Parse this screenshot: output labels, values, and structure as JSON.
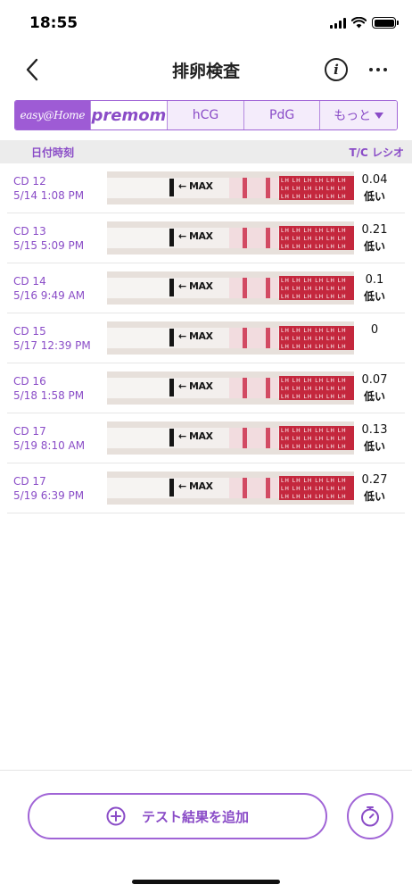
{
  "status_bar": {
    "time": "18:55"
  },
  "nav": {
    "title": "排卵検査"
  },
  "tabs": {
    "easy": "easy@Home",
    "premom": "premom",
    "hcg": "hCG",
    "pdg": "PdG",
    "more": "もっと"
  },
  "columns": {
    "date": "日付時刻",
    "ratio": "T/C レシオ"
  },
  "strip_text": {
    "max": "MAX",
    "lh": "LH LH LH LH LH LH LH LH LH LH LH LH LH LH LH LH LH LH LH LH LH LH LH LH"
  },
  "records": [
    {
      "cd": "CD 12",
      "date": "5/14 1:08 PM",
      "ratio": "0.04",
      "status": "低い"
    },
    {
      "cd": "CD 13",
      "date": "5/15 5:09 PM",
      "ratio": "0.21",
      "status": "低い"
    },
    {
      "cd": "CD 14",
      "date": "5/16 9:49 AM",
      "ratio": "0.1",
      "status": "低い"
    },
    {
      "cd": "CD 15",
      "date": "5/17 12:39 PM",
      "ratio": "0",
      "status": ""
    },
    {
      "cd": "CD 16",
      "date": "5/18 1:58 PM",
      "ratio": "0.07",
      "status": "低い"
    },
    {
      "cd": "CD 17",
      "date": "5/19 8:10 AM",
      "ratio": "0.13",
      "status": "低い"
    },
    {
      "cd": "CD 17",
      "date": "5/19 6:39 PM",
      "ratio": "0.27",
      "status": "低い"
    }
  ],
  "actions": {
    "add_label": "テスト結果を追加"
  },
  "colors": {
    "accent": "#8a4cc7",
    "accent_border": "#a064d6",
    "lh_red": "#c4273d"
  }
}
